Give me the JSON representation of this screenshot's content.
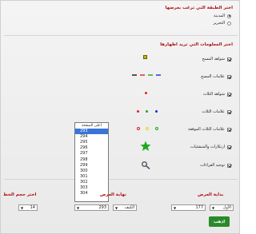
{
  "print_section": {
    "title": "اختر الطبقة التي ترغب بعرضها",
    "options": [
      {
        "label": "المدينة",
        "selected": true
      },
      {
        "label": "التحرير",
        "selected": false
      }
    ]
  },
  "layers_section": {
    "title": "اختر المعلومات التي تريد اظهارها",
    "items": [
      {
        "label": "شواهد المسح",
        "checked": true,
        "icon": "survey-marker-icon"
      },
      {
        "label": "علامات المسح",
        "checked": true,
        "icon": "survey-line-icon"
      },
      {
        "label": "شواهد الثلاث",
        "checked": true,
        "icon": "red-point-icon"
      },
      {
        "label": "علامات الثلاث",
        "checked": true,
        "icon": "colored-points-icon"
      },
      {
        "label": "علامات الثلاث الموقعة",
        "checked": true,
        "icon": "colored-rings-icon"
      },
      {
        "label": "ارتكازات والمنشئيات",
        "checked": true,
        "icon": "green-star-icon"
      },
      {
        "label": "توجيه القراءات",
        "checked": true,
        "icon": "wrench-icon"
      }
    ],
    "colors": {
      "red": "#e02020",
      "green": "#1fa81f",
      "blue": "#1a2ad8",
      "yellow": "#e8d020"
    }
  },
  "listbox": {
    "items": [
      "أعلى الصفحة",
      "293",
      "294",
      "295",
      "296",
      "297",
      "298",
      "299",
      "300",
      "301",
      "302",
      "303",
      "304"
    ],
    "selected_index": 1
  },
  "controls": {
    "font_size_label": "اختر حجم الخط",
    "font_size_value": "14",
    "end_label": "نهاية العرض",
    "end_value": "293",
    "end_unit": "الكيف",
    "start_label": "بداية العرض",
    "start_value": "177",
    "start_unit": "الأول"
  },
  "submit_label": "اذهب"
}
